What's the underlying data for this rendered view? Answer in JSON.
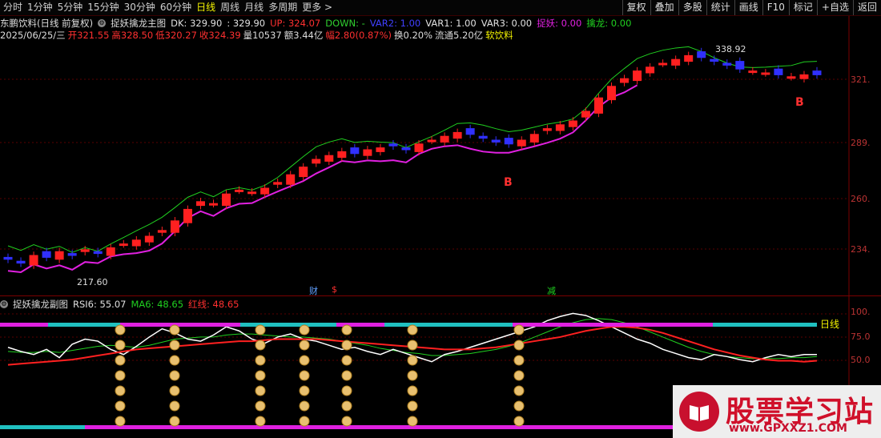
{
  "toolbar": {
    "tabs": [
      "分时",
      "1分钟",
      "5分钟",
      "15分钟",
      "30分钟",
      "60分钟",
      "日线",
      "周线",
      "月线",
      "多周期",
      "更多"
    ],
    "active_tab": "日线",
    "right_buttons": [
      "复权",
      "叠加",
      "多股",
      "统计",
      "画线",
      "F10",
      "标记",
      "+自选",
      "返回"
    ]
  },
  "header1": {
    "stock": "东鹏饮料(日线 前复权)",
    "indicator": "捉妖擒龙主图",
    "dk": "DK: 329.90",
    "val2": ": 329.90",
    "up": "UP: 324.07",
    "down": "DOWN: -",
    "var2": "VAR2: 1.00",
    "var1": "VAR1: 1.00",
    "var3": "VAR3: 0.00",
    "zhuoyao": "捉妖: 0.00",
    "qinlong": "擒龙: 0.00"
  },
  "header2": {
    "date": "2025/06/25/三",
    "open": "开321.55",
    "high": "高328.50",
    "low": "低320.27",
    "close": "收324.39",
    "vol": "量10537",
    "amount": "额3.44亿",
    "change": "幅2.80(0.87%)",
    "turnover": "换0.20%",
    "float": "流通5.20亿",
    "sector": "软饮料"
  },
  "axis_labels": [
    "321.",
    "289.",
    "260.",
    "234."
  ],
  "sub_axis_labels": [
    "100.",
    "75.0",
    "50.0"
  ],
  "annotations": {
    "high": "338.92",
    "low": "217.60",
    "b1": "B",
    "b2": "B",
    "cai": "财",
    "s": "$",
    "jian": "减",
    "period": "日线"
  },
  "sub_header": {
    "name": "捉妖擒龙副图",
    "rsi6": "RSI6: 55.07",
    "ma6": "MA6: 48.65",
    "red": "红线: 48.65"
  },
  "logo": {
    "title": "股票学习站",
    "url": "www.GPXXZ1.COM"
  },
  "colors": {
    "up": "#ff2020",
    "down": "#3030ff",
    "magenta": "#e020e0",
    "green": "#20d020",
    "cyan": "#20c0c0"
  },
  "chart_data": {
    "type": "candlestick",
    "closes": [
      228,
      226,
      230,
      229,
      232,
      230,
      233,
      231,
      234,
      236,
      238,
      240,
      243,
      248,
      254,
      258,
      257,
      262,
      264,
      263,
      265,
      268,
      272,
      276,
      280,
      282,
      284,
      283,
      285,
      286,
      287,
      285,
      288,
      290,
      292,
      294,
      293,
      291,
      289,
      288,
      290,
      293,
      296,
      298,
      300,
      305,
      312,
      318,
      322,
      326,
      328,
      330,
      332,
      334,
      333,
      331,
      329,
      327,
      326,
      325,
      324,
      323,
      324,
      324
    ],
    "rsi6": [
      62,
      58,
      55,
      60,
      52,
      65,
      70,
      68,
      60,
      55,
      63,
      72,
      80,
      76,
      70,
      68,
      74,
      82,
      78,
      70,
      66,
      72,
      75,
      70,
      68,
      64,
      60,
      62,
      58,
      55,
      60,
      56,
      52,
      48,
      55,
      58,
      62,
      66,
      70,
      74,
      78,
      82,
      88,
      92,
      95,
      93,
      88,
      82,
      76,
      70,
      66,
      60,
      56,
      52,
      50,
      55,
      53,
      50,
      48,
      52,
      55,
      53,
      55,
      55
    ],
    "ma6": [
      58,
      57,
      57,
      58,
      57,
      59,
      61,
      63,
      64,
      63,
      62,
      64,
      67,
      70,
      71,
      72,
      72,
      74,
      75,
      75,
      74,
      73,
      72,
      72,
      71,
      70,
      68,
      66,
      64,
      61,
      59,
      57,
      56,
      54,
      54,
      55,
      56,
      58,
      60,
      63,
      67,
      72,
      77,
      82,
      86,
      89,
      90,
      89,
      86,
      82,
      77,
      72,
      67,
      62,
      58,
      55,
      53,
      52,
      51,
      51,
      51,
      52,
      52,
      53
    ],
    "red_line": [
      45,
      46,
      47,
      48,
      49,
      50,
      52,
      54,
      56,
      58,
      60,
      61,
      62,
      63,
      64,
      65,
      66,
      67,
      68,
      68,
      69,
      70,
      70,
      70,
      70,
      69,
      68,
      67,
      66,
      65,
      64,
      63,
      62,
      61,
      60,
      60,
      60,
      61,
      62,
      64,
      66,
      68,
      70,
      72,
      75,
      78,
      80,
      82,
      82,
      81,
      79,
      76,
      72,
      68,
      64,
      60,
      57,
      54,
      52,
      50,
      49,
      49,
      48,
      49
    ]
  }
}
